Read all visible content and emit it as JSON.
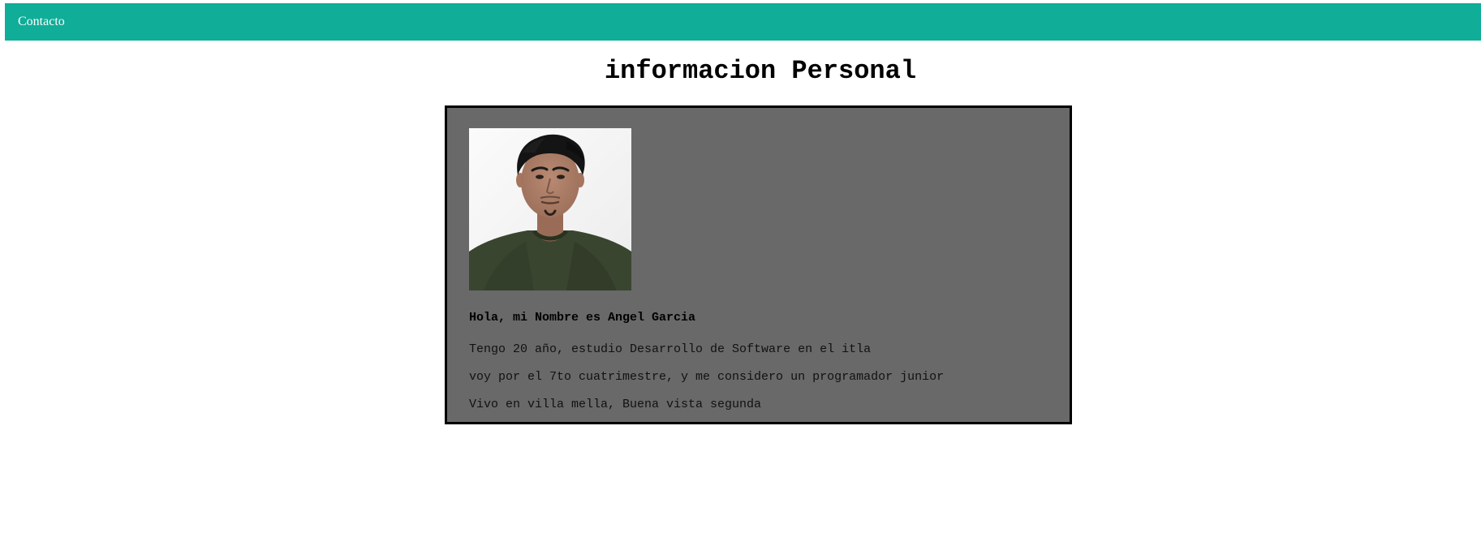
{
  "navbar": {
    "links": [
      {
        "label": "Contacto"
      }
    ]
  },
  "main": {
    "title": "informacion Personal",
    "card": {
      "photo_subject": "profile-photo",
      "heading": "Hola, mi Nombre es Angel Garcia",
      "bio": [
        "Tengo 20 año, estudio Desarrollo de Software en el itla",
        "voy por el 7to cuatrimestre, y me considero un programador junior",
        "Vivo en villa mella, Buena vista segunda"
      ]
    }
  },
  "colors": {
    "navbar_bg": "#10ad98",
    "card_bg": "#696969",
    "card_border": "#000000",
    "nav_text": "#ffffff"
  }
}
